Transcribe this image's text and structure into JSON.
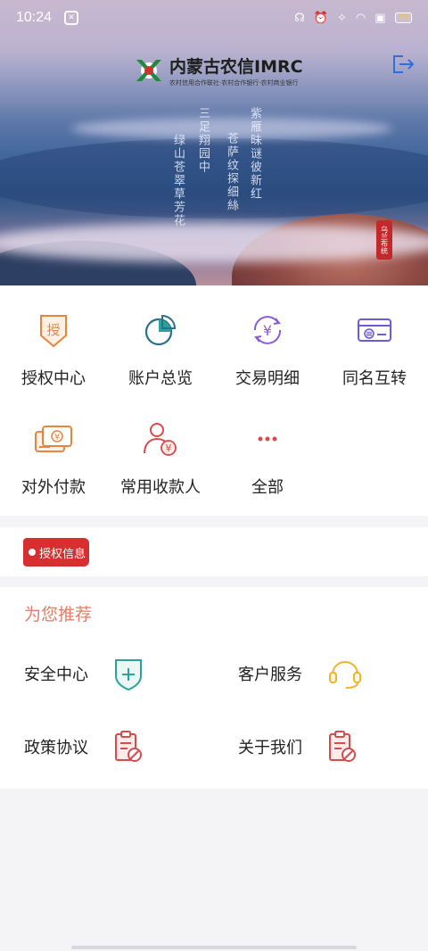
{
  "status_bar": {
    "time": "10:24",
    "battery": "53"
  },
  "brand": {
    "name": "内蒙古农信IMRC",
    "subtitle": "农村信用合作联社·农村合作银行·农村商业银行"
  },
  "hero": {
    "poem_lines": [
      "紫雁昧谜彼新红",
      "苍萨纹探细絲",
      "三足翔园中",
      "绿山苍翠草芳花"
    ],
    "seal": "乌兰布统"
  },
  "functions": [
    {
      "label": "授权中心",
      "icon": "authorization-icon"
    },
    {
      "label": "账户总览",
      "icon": "pie-chart-icon"
    },
    {
      "label": "交易明细",
      "icon": "yuan-cycle-icon"
    },
    {
      "label": "同名互转",
      "icon": "card-transfer-icon"
    },
    {
      "label": "对外付款",
      "icon": "payment-card-icon"
    },
    {
      "label": "常用收款人",
      "icon": "payee-icon"
    },
    {
      "label": "全部",
      "icon": "more-icon"
    }
  ],
  "auth_info": {
    "label": "授权信息"
  },
  "recommend": {
    "title": "为您推荐",
    "items": [
      {
        "label": "安全中心",
        "icon": "shield-plus-icon"
      },
      {
        "label": "客户服务",
        "icon": "headset-icon"
      },
      {
        "label": "政策协议",
        "icon": "clipboard-icon"
      },
      {
        "label": "关于我们",
        "icon": "clipboard-icon"
      }
    ]
  },
  "colors": {
    "accent_orange": "#e8843c",
    "accent_red": "#d72f2f",
    "recommend_title": "#e97a66",
    "teal": "#2aa39a",
    "purple": "#8a5cd6",
    "yellow": "#f0b429"
  }
}
